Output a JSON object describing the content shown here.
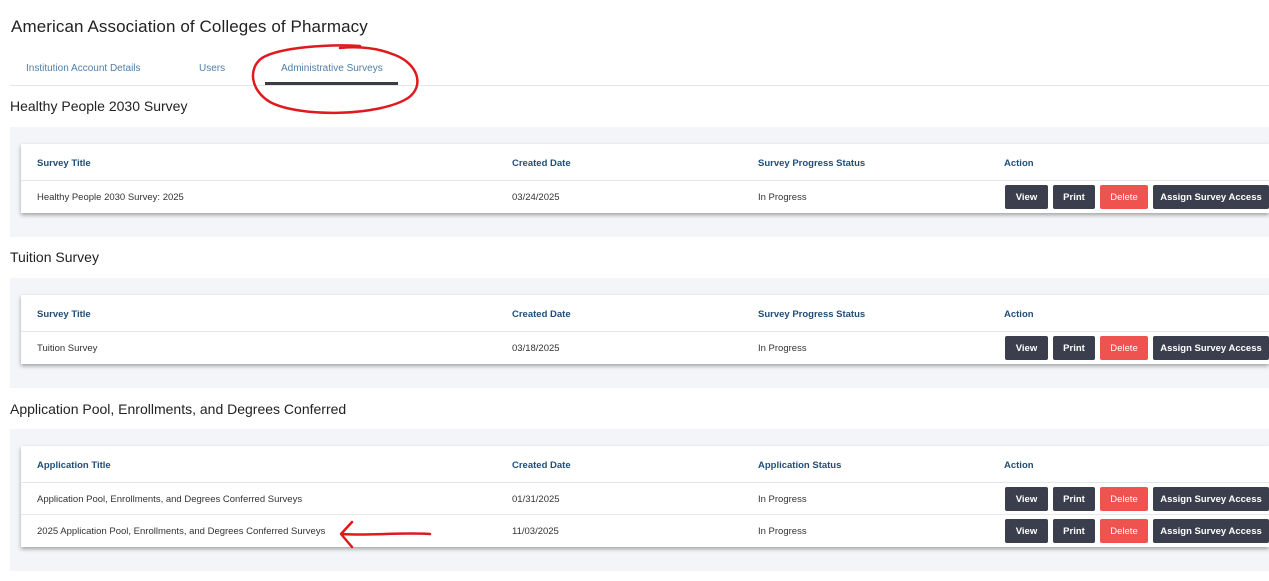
{
  "org_title": "American Association of Colleges of Pharmacy",
  "tabs": [
    {
      "label": "Institution Account Details",
      "active": false
    },
    {
      "label": "Users",
      "active": false
    },
    {
      "label": "Administrative Surveys",
      "active": true
    }
  ],
  "sections": [
    {
      "title": "Healthy People 2030 Survey",
      "headers": [
        "Survey Title",
        "Created Date",
        "Survey Progress Status",
        "Action"
      ],
      "rows": [
        {
          "title": "Healthy People 2030 Survey: 2025",
          "date": "03/24/2025",
          "status": "In Progress"
        }
      ]
    },
    {
      "title": "Tuition Survey",
      "headers": [
        "Survey Title",
        "Created Date",
        "Survey Progress Status",
        "Action"
      ],
      "rows": [
        {
          "title": "Tuition Survey",
          "date": "03/18/2025",
          "status": "In Progress"
        }
      ]
    },
    {
      "title": "Application Pool, Enrollments, and Degrees Conferred",
      "headers": [
        "Application Title",
        "Created Date",
        "Application Status",
        "Action"
      ],
      "rows": [
        {
          "title": "Application Pool, Enrollments, and Degrees Conferred Surveys",
          "date": "01/31/2025",
          "status": "In Progress"
        },
        {
          "title": "2025 Application Pool, Enrollments, and Degrees Conferred Surveys",
          "date": "11/03/2025",
          "status": "In Progress"
        }
      ]
    }
  ],
  "actions": {
    "view": "View",
    "print": "Print",
    "delete": "Delete",
    "assign": "Assign Survey Access"
  },
  "colors": {
    "header_text": "#1f4e79",
    "tab_text": "#4f7fa6",
    "dark_button": "#3b3f4d",
    "delete_button": "#ef5350",
    "panel_bg": "#f3f5f8",
    "annotation": "#e0191d"
  }
}
